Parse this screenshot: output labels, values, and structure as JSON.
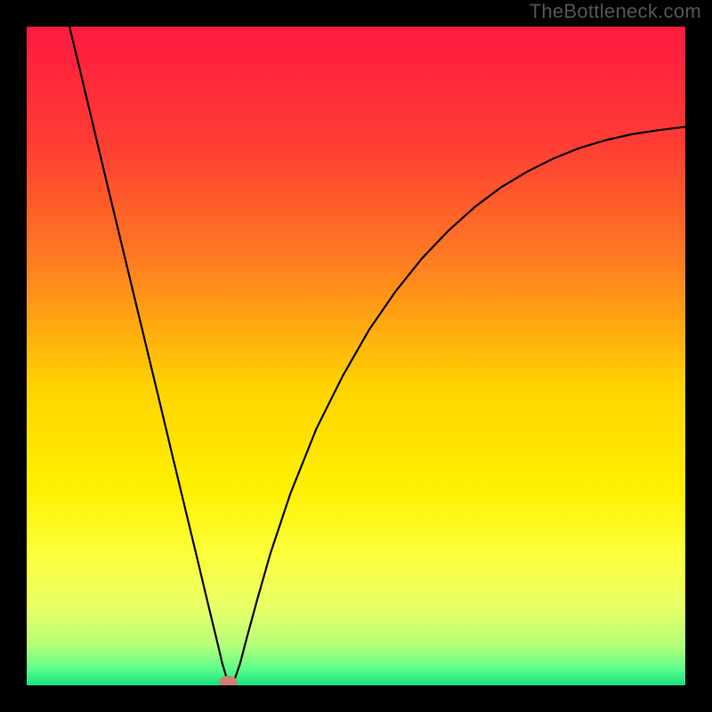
{
  "watermark": "TheBottleneck.com",
  "chart_data": {
    "type": "line",
    "title": "",
    "xlabel": "",
    "ylabel": "",
    "xlim": [
      0,
      1
    ],
    "ylim": [
      0,
      1
    ],
    "background_gradient": {
      "stops": [
        {
          "offset": 0.0,
          "color": "#ff1a3f"
        },
        {
          "offset": 0.18,
          "color": "#ff3d33"
        },
        {
          "offset": 0.35,
          "color": "#ff7a22"
        },
        {
          "offset": 0.55,
          "color": "#ffd400"
        },
        {
          "offset": 0.7,
          "color": "#fff000"
        },
        {
          "offset": 0.8,
          "color": "#fbff3a"
        },
        {
          "offset": 0.88,
          "color": "#eaff66"
        },
        {
          "offset": 0.94,
          "color": "#b4ff7a"
        },
        {
          "offset": 0.975,
          "color": "#5dff8a"
        },
        {
          "offset": 1.0,
          "color": "#18e083"
        }
      ]
    },
    "minimum_marker": {
      "x": 0.306,
      "y": 0.005,
      "color": "#d08070",
      "rx": 10,
      "ry": 7
    },
    "series": [
      {
        "name": "bottleneck-curve",
        "color": "#000000",
        "width": 2.2,
        "x": [
          0.065,
          0.08,
          0.1,
          0.12,
          0.14,
          0.16,
          0.18,
          0.2,
          0.22,
          0.24,
          0.26,
          0.275,
          0.29,
          0.297,
          0.304,
          0.31,
          0.316,
          0.324,
          0.335,
          0.35,
          0.37,
          0.4,
          0.44,
          0.48,
          0.52,
          0.56,
          0.6,
          0.64,
          0.68,
          0.72,
          0.76,
          0.8,
          0.84,
          0.88,
          0.92,
          0.96,
          1.0
        ],
        "y": [
          1.0,
          0.938,
          0.854,
          0.77,
          0.687,
          0.604,
          0.521,
          0.438,
          0.354,
          0.271,
          0.188,
          0.125,
          0.063,
          0.033,
          0.01,
          0.003,
          0.01,
          0.033,
          0.075,
          0.13,
          0.2,
          0.29,
          0.39,
          0.47,
          0.54,
          0.598,
          0.648,
          0.69,
          0.726,
          0.756,
          0.78,
          0.8,
          0.816,
          0.828,
          0.837,
          0.843,
          0.848
        ]
      }
    ]
  }
}
